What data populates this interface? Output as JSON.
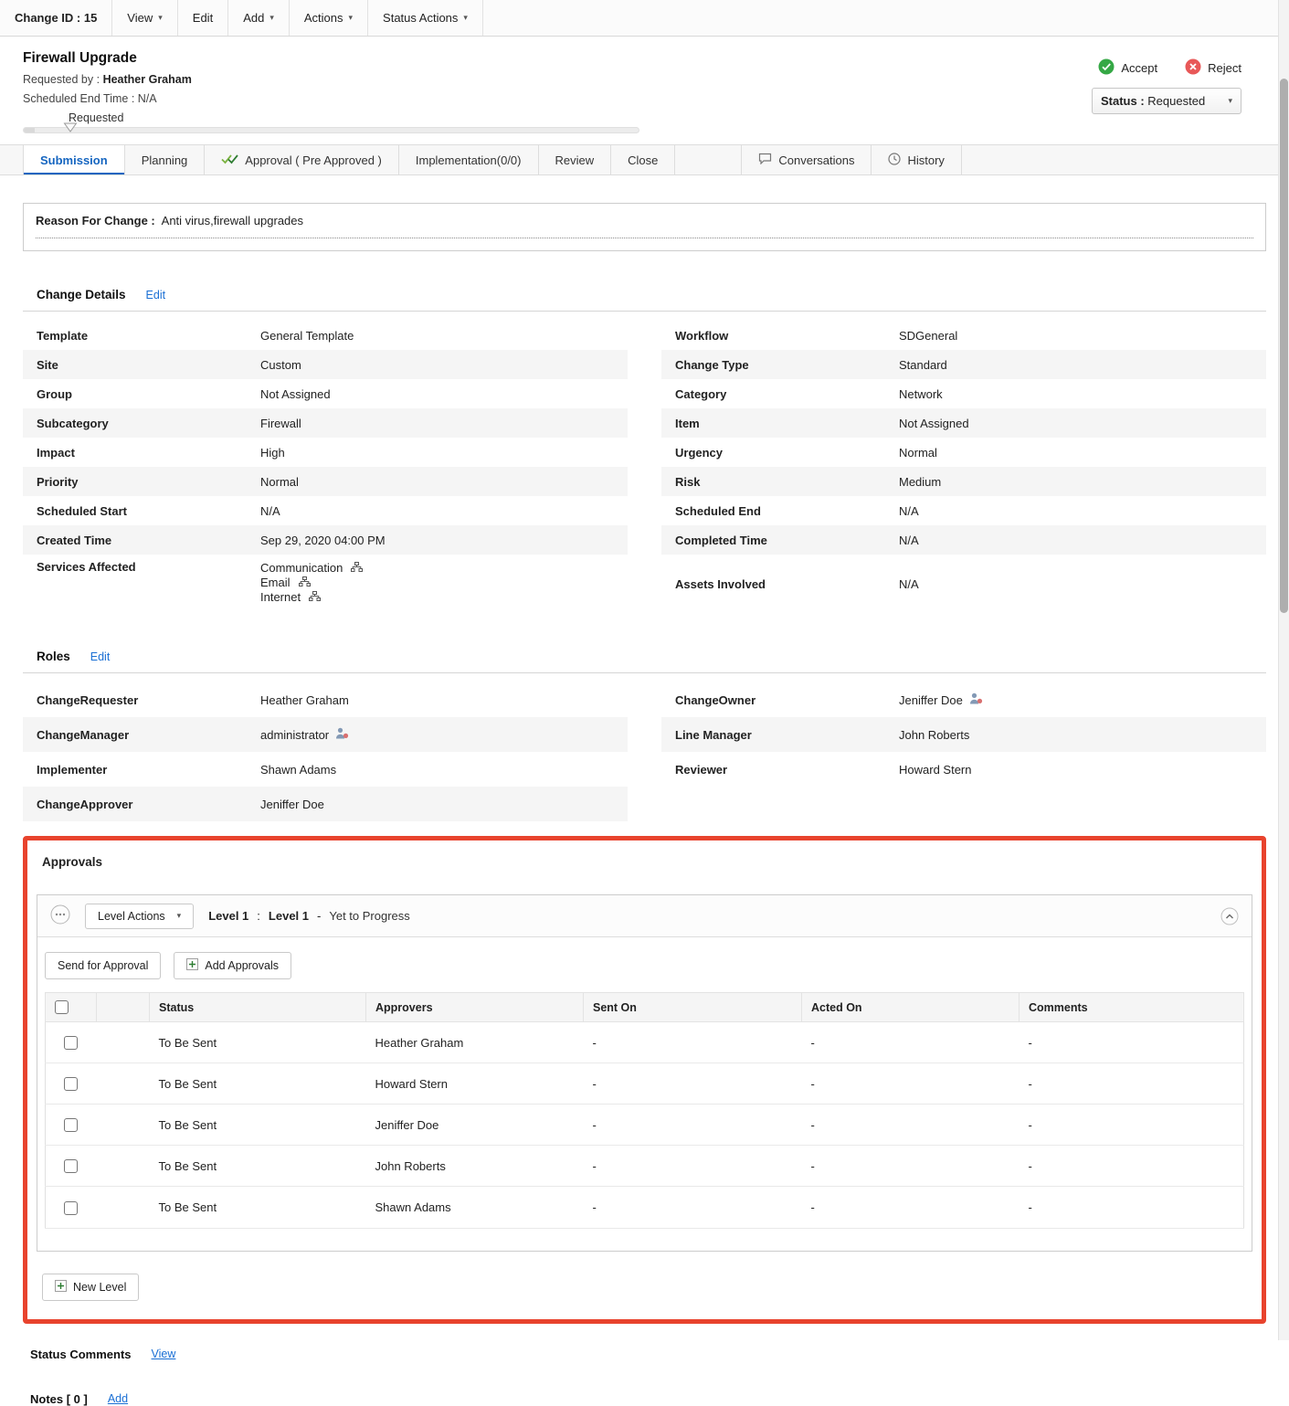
{
  "topbar": {
    "change_id": "Change ID : 15",
    "view": "View",
    "edit": "Edit",
    "add": "Add",
    "actions": "Actions",
    "status_actions": "Status Actions"
  },
  "header": {
    "title": "Firewall Upgrade",
    "requested_by_label": "Requested by :",
    "requested_by_value": "Heather Graham",
    "scheduled_end_label": "Scheduled End Time :",
    "scheduled_end_value": "N/A",
    "stage_label": "Requested",
    "accept": "Accept",
    "reject": "Reject",
    "status_label": "Status :",
    "status_value": "Requested"
  },
  "tabs": {
    "submission": "Submission",
    "planning": "Planning",
    "approval": "Approval ( Pre Approved )",
    "implementation": "Implementation(0/0)",
    "review": "Review",
    "close": "Close",
    "conversations": "Conversations",
    "history": "History"
  },
  "reason": {
    "label": "Reason For Change :",
    "value": "Anti virus,firewall upgrades"
  },
  "change_details": {
    "title": "Change Details",
    "edit": "Edit",
    "left": [
      {
        "label": "Template",
        "value": "General Template"
      },
      {
        "label": "Site",
        "value": "Custom"
      },
      {
        "label": "Group",
        "value": "Not Assigned"
      },
      {
        "label": "Subcategory",
        "value": "Firewall"
      },
      {
        "label": "Impact",
        "value": "High"
      },
      {
        "label": "Priority",
        "value": "Normal"
      },
      {
        "label": "Scheduled Start",
        "value": "N/A"
      },
      {
        "label": "Created Time",
        "value": "Sep 29, 2020 04:00 PM"
      }
    ],
    "services": {
      "label": "Services Affected",
      "items": [
        "Communication",
        "Email",
        "Internet"
      ]
    },
    "right": [
      {
        "label": "Workflow",
        "value": "SDGeneral"
      },
      {
        "label": "Change Type",
        "value": "Standard"
      },
      {
        "label": "Category",
        "value": "Network"
      },
      {
        "label": "Item",
        "value": "Not Assigned"
      },
      {
        "label": "Urgency",
        "value": "Normal"
      },
      {
        "label": "Risk",
        "value": "Medium"
      },
      {
        "label": "Scheduled End",
        "value": "N/A"
      },
      {
        "label": "Completed Time",
        "value": "N/A"
      },
      {
        "label": "Assets Involved",
        "value": "N/A"
      }
    ]
  },
  "roles": {
    "title": "Roles",
    "edit": "Edit",
    "left": [
      {
        "label": "ChangeRequester",
        "value": "Heather Graham"
      },
      {
        "label": "ChangeManager",
        "value": "administrator"
      },
      {
        "label": "Implementer",
        "value": "Shawn Adams"
      },
      {
        "label": "ChangeApprover",
        "value": "Jeniffer Doe"
      }
    ],
    "right": [
      {
        "label": "ChangeOwner",
        "value": "Jeniffer Doe"
      },
      {
        "label": "Line Manager",
        "value": "John Roberts"
      },
      {
        "label": "Reviewer",
        "value": "Howard Stern"
      }
    ]
  },
  "approvals": {
    "title": "Approvals",
    "level_actions": "Level Actions",
    "level_no": "Level  1",
    "colon": ":",
    "level_name": "Level 1",
    "dash": "-",
    "level_status": "Yet to Progress",
    "send_for_approval": "Send for Approval",
    "add_approvals": "Add Approvals",
    "headers": {
      "status": "Status",
      "approvers": "Approvers",
      "sent_on": "Sent On",
      "acted_on": "Acted On",
      "comments": "Comments"
    },
    "rows": [
      {
        "status": "To Be Sent",
        "approver": "Heather Graham",
        "sent_on": "-",
        "acted_on": "-",
        "comments": "-"
      },
      {
        "status": "To Be Sent",
        "approver": "Howard Stern",
        "sent_on": "-",
        "acted_on": "-",
        "comments": "-"
      },
      {
        "status": "To Be Sent",
        "approver": "Jeniffer Doe",
        "sent_on": "-",
        "acted_on": "-",
        "comments": "-"
      },
      {
        "status": "To Be Sent",
        "approver": "John Roberts",
        "sent_on": "-",
        "acted_on": "-",
        "comments": "-"
      },
      {
        "status": "To Be Sent",
        "approver": "Shawn Adams",
        "sent_on": "-",
        "acted_on": "-",
        "comments": "-"
      }
    ],
    "new_level": "New Level"
  },
  "status_comments": {
    "title": "Status Comments",
    "view": "View"
  },
  "notes": {
    "title": "Notes  [ 0 ]",
    "add": "Add"
  },
  "colors": {
    "accent_red": "#e8432d",
    "link_blue": "#1a6fd4",
    "accept_green": "#35a845",
    "reject_red": "#e85858"
  }
}
